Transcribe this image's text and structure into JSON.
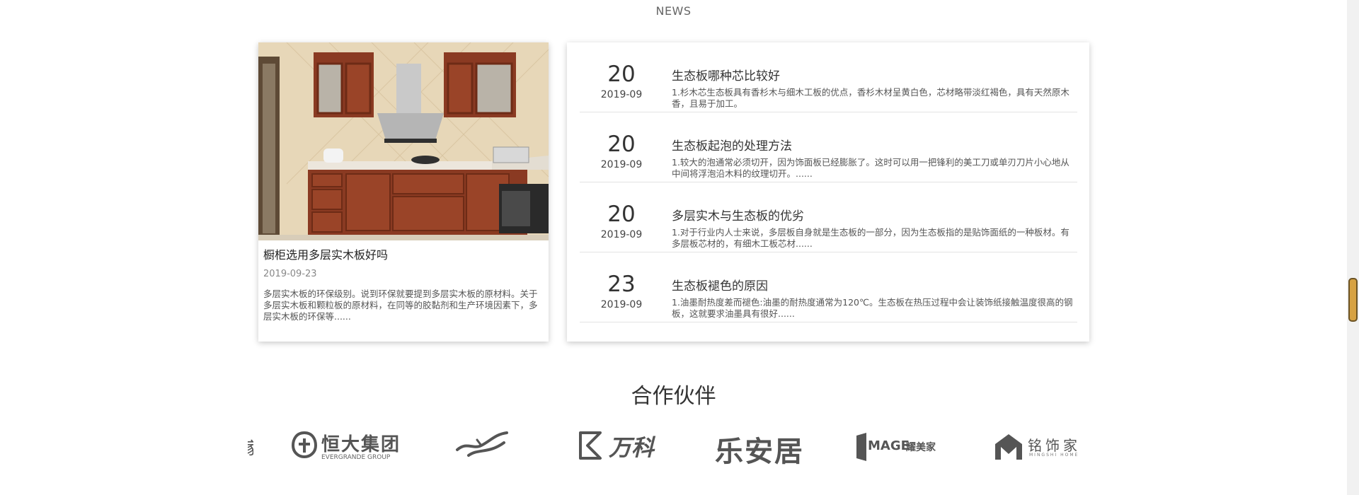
{
  "news_section": {
    "subtitle": "NEWS",
    "featured": {
      "title": "橱柜选用多层实木板好吗",
      "date": "2019-09-23",
      "summary": "多层实木板的环保级别。说到环保就要提到多层实木板的原材料。关于多层实木板和颗粒板的原材料，在同等的胶黏剂和生产环境因素下，多层实木板的环保等......"
    },
    "items": [
      {
        "day": "20",
        "year_month": "2019-09",
        "title": "生态板哪种芯比较好",
        "summary": "1.杉木芯生态板具有香杉木与细木工板的优点，香杉木材呈黄白色，芯材略带淡红褐色，具有天然原木香，且易于加工。"
      },
      {
        "day": "20",
        "year_month": "2019-09",
        "title": "生态板起泡的处理方法",
        "summary": "1.较大的泡通常必须切开，因为饰面板已经膨胀了。这时可以用一把锋利的美工刀或单刃刀片小心地从中间将浮泡沿木料的纹理切开。......"
      },
      {
        "day": "20",
        "year_month": "2019-09",
        "title": "多层实木与生态板的优劣",
        "summary": "1.对于行业内人士来说，多层板自身就是生态板的一部分，因为生态板指的是贴饰面纸的一种板材。有多层板芯材的，有细木工板芯材......"
      },
      {
        "day": "23",
        "year_month": "2019-09",
        "title": "生态板褪色的原因",
        "summary": "1.油墨耐热度差而褪色:油墨的耐热度通常为120℃。生态板在热压过程中会让装饰纸接触温度很高的钢板，这就要求油墨具有很好......"
      }
    ]
  },
  "partners": {
    "title": "合作伙伴",
    "logos": [
      {
        "name": "evergrande",
        "text": "恒大集团",
        "sub": "EVERGRANDE GROUP",
        "icon": "evergrande-logo-icon"
      },
      {
        "name": "bird-brand",
        "icon": "bird-logo-icon"
      },
      {
        "name": "vanke",
        "text": "万科",
        "icon": "vanke-logo-icon"
      },
      {
        "name": "leanju",
        "text": "乐安居"
      },
      {
        "name": "mage",
        "text": "MAGE",
        "cn": "耀美家",
        "icon": "mage-logo-icon"
      },
      {
        "name": "mingshi",
        "text": "铭饰家",
        "sub": "MINGSHI HOME",
        "icon": "mingshi-logo-icon"
      }
    ]
  },
  "colors": {
    "accent_scroll": "#d7a243",
    "text": "#333333",
    "muted": "#888888"
  }
}
